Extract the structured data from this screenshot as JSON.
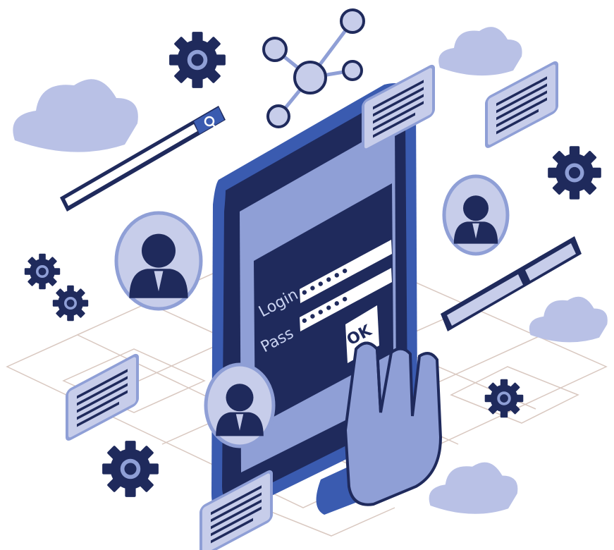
{
  "phone": {
    "login_label": "Login",
    "login_value": "••••••",
    "pass_label": "Pass",
    "pass_value": "••••••",
    "ok_label": "OK"
  },
  "colors": {
    "navy": "#1f2a5c",
    "blue": "#3a5bb0",
    "periwinkle": "#8f9fd6",
    "light": "#c7cdea",
    "cloud": "#b9c1e6",
    "white": "#ffffff"
  },
  "icons": [
    "gear-icon",
    "network-icon",
    "cloud-icon",
    "search-icon",
    "user-icon",
    "text-card-icon",
    "hand-pointer-icon"
  ]
}
